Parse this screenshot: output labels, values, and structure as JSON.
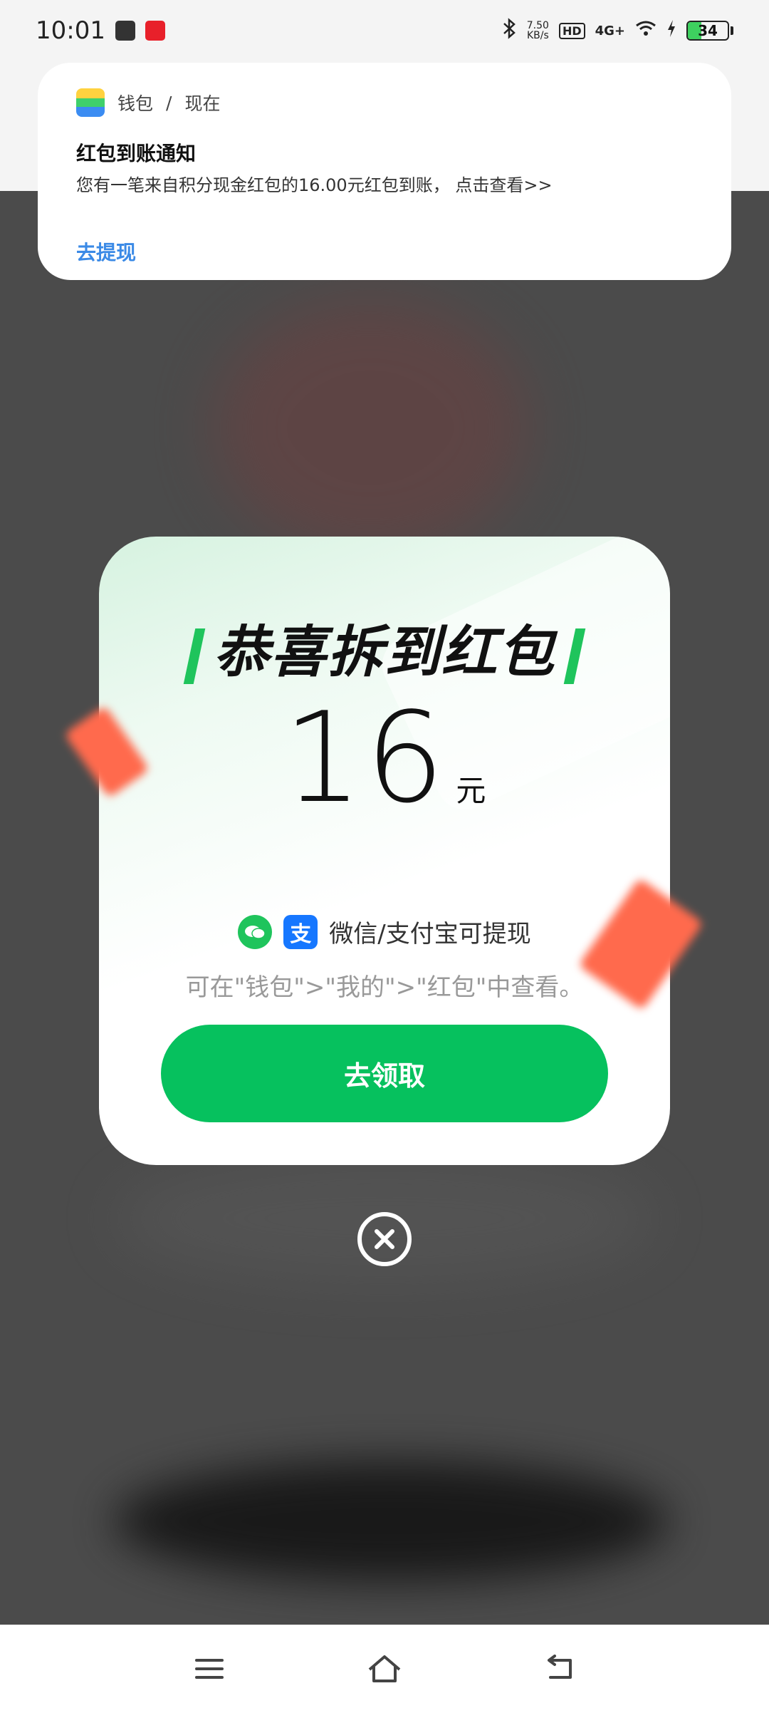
{
  "status_bar": {
    "time": "10:01",
    "net_speed_value": "7.50",
    "net_speed_unit": "KB/s",
    "hd": "HD",
    "network": "4G+",
    "battery": "34"
  },
  "notification": {
    "app": "钱包",
    "separator": "/",
    "time": "现在",
    "title": "红包到账通知",
    "body": "您有一笔来自积分现金红包的16.00元红包到账， 点击查看>>",
    "action": "去提现"
  },
  "card": {
    "title": "恭喜拆到红包",
    "amount": "16",
    "unit": "元",
    "withdraw_text": "微信/支付宝可提现",
    "alipay_glyph": "支",
    "hint": "可在\"钱包\">\"我的\">\"红包\"中查看。",
    "claim_button": "去领取"
  },
  "icons": {
    "close": "close-icon",
    "menu": "menu-icon",
    "home": "home-icon",
    "back": "back-icon"
  },
  "colors": {
    "accent_green": "#06c15e",
    "link_blue": "#3b8ae6",
    "alipay_blue": "#1677ff"
  }
}
